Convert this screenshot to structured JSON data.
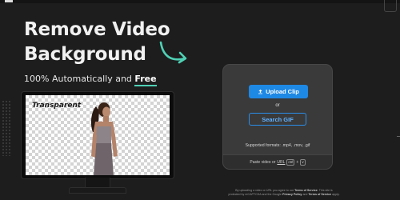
{
  "hero": {
    "title_line1": "Remove Video",
    "title_line2": "Background",
    "subtitle_prefix": "100% Automatically and ",
    "subtitle_free": "Free",
    "accent_color": "#4fd1b5"
  },
  "preview": {
    "label": "Transparent"
  },
  "upload": {
    "upload_button": "Upload Clip",
    "or": "or",
    "search_button": "Search GIF",
    "supported_formats": "Supported formats: .mp4, .mov, .gif",
    "paste_prefix": "Paste video or",
    "paste_url": "URL",
    "kbd_ctrl": "ctrl",
    "kbd_plus": "+",
    "kbd_v": "v",
    "button_color": "#1e88e5"
  },
  "legal": {
    "line1_prefix": "By uploading a video or URL you agree to our",
    "terms_of_service": "Terms of Service",
    "line1_suffix": ". This site is",
    "line2_prefix": "protected by reCAPTCHA and the Google",
    "privacy_policy": "Privacy Policy",
    "and": "and",
    "terms_of_service_2": "Terms of Service",
    "line2_suffix": "apply."
  }
}
